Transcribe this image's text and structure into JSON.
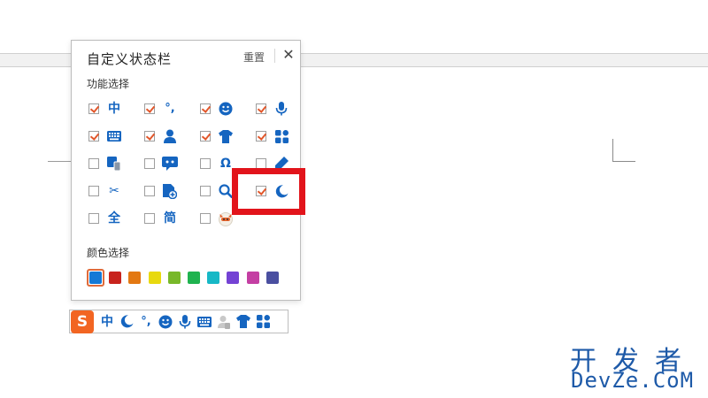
{
  "panel": {
    "title": "自定义状态栏",
    "reset_label": "重置",
    "close_glyph": "✕",
    "func_section_label": "功能选择",
    "color_section_label": "颜色选择",
    "functions": [
      {
        "icon": "chinese-mode-icon",
        "glyph": "中",
        "checked": true
      },
      {
        "icon": "punctuation-icon",
        "glyph": "°,",
        "checked": true
      },
      {
        "icon": "emoji-icon",
        "checked": true
      },
      {
        "icon": "microphone-icon",
        "checked": true
      },
      {
        "icon": "keyboard-icon",
        "checked": true
      },
      {
        "icon": "user-icon",
        "checked": true
      },
      {
        "icon": "skin-shirt-icon",
        "checked": true
      },
      {
        "icon": "toolbox-icon",
        "checked": true
      },
      {
        "icon": "device-icon",
        "checked": false
      },
      {
        "icon": "chat-bot-icon",
        "checked": false
      },
      {
        "icon": "omega-symbol-icon",
        "glyph": "Ω",
        "checked": false
      },
      {
        "icon": "pen-icon",
        "checked": false
      },
      {
        "icon": "scissors-icon",
        "glyph": "✂",
        "checked": false
      },
      {
        "icon": "file-add-icon",
        "checked": false
      },
      {
        "icon": "search-icon",
        "checked": false
      },
      {
        "icon": "moon-icon",
        "checked": true
      },
      {
        "icon": "full-width-icon",
        "glyph": "全",
        "checked": false
      },
      {
        "icon": "simplified-icon",
        "glyph": "简",
        "checked": false
      },
      {
        "icon": "mascot-icon",
        "checked": false
      }
    ],
    "colors": [
      "#1479d6",
      "#c8231d",
      "#e37812",
      "#e8d90f",
      "#78b829",
      "#1fb34f",
      "#17b8c6",
      "#7442d4",
      "#c43fa3",
      "#4a4fa0"
    ],
    "selected_color_index": 0
  },
  "statusbar": {
    "logo_glyph": "S",
    "icons": [
      "chinese-mode-icon",
      "moon-icon",
      "punctuation-icon",
      "emoji-icon",
      "microphone-icon",
      "keyboard-icon",
      "user-icon",
      "skin-shirt-icon",
      "toolbox-icon"
    ],
    "chinese_glyph": "中"
  },
  "watermark": {
    "line1": "开发者",
    "line2": "DevZe.CoM"
  }
}
